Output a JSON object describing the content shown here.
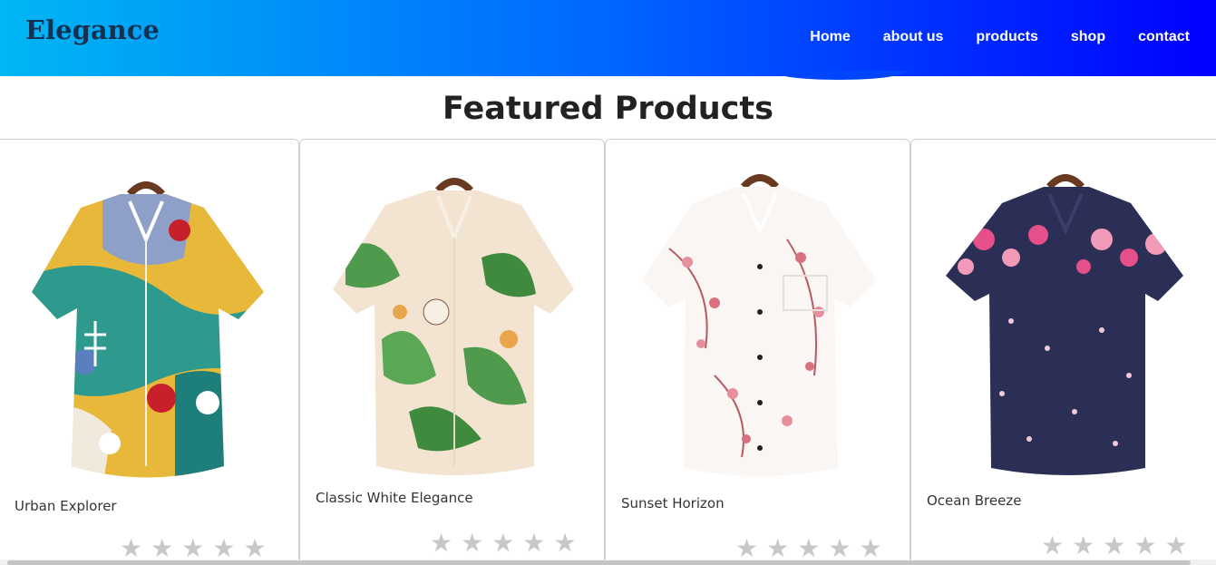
{
  "header": {
    "logo": "Elegance",
    "nav": [
      "Home",
      "about us",
      "products",
      "shop",
      "contact"
    ]
  },
  "featured": {
    "title": "Featured Products",
    "products": [
      {
        "name": "Urban Explorer",
        "rating": 0,
        "max_rating": 5,
        "pattern": "abstract-multicolor-shirt"
      },
      {
        "name": "Classic White Elegance",
        "rating": 0,
        "max_rating": 5,
        "pattern": "green-lily-shirt"
      },
      {
        "name": "Sunset Horizon",
        "rating": 0,
        "max_rating": 5,
        "pattern": "pink-blossom-shirt"
      },
      {
        "name": "Ocean Breeze",
        "rating": 0,
        "max_rating": 5,
        "pattern": "navy-floral-shirt"
      }
    ]
  },
  "colors": {
    "header_start": "#00b7f3",
    "header_end": "#0000ff",
    "star_empty": "#c8c8c8"
  }
}
